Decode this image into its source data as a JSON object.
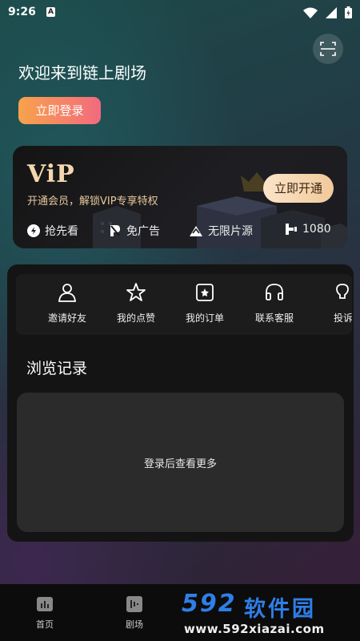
{
  "status_bar": {
    "time": "9:26",
    "notification_icon": "A",
    "icons": [
      "wifi-icon",
      "signal-icon",
      "battery-icon"
    ]
  },
  "header": {
    "welcome": "欢迎来到链上剧场",
    "login_label": "立即登录",
    "scan_icon": "scan-icon"
  },
  "vip": {
    "logo": "ViP",
    "subtitle": "开通会员，解锁VIP专享特权",
    "open_label": "立即开通",
    "perks": [
      {
        "icon": "lightning-icon",
        "label": "抢先看"
      },
      {
        "icon": "no-ad-icon",
        "label": "免广告"
      },
      {
        "icon": "film-icon",
        "label": "无限片源"
      },
      {
        "icon": "hd-icon",
        "label": "1080"
      }
    ]
  },
  "quick_actions": [
    {
      "icon": "invite-user-icon",
      "label": "邀请好友"
    },
    {
      "icon": "star-icon",
      "label": "我的点赞"
    },
    {
      "icon": "order-icon",
      "label": "我的订单"
    },
    {
      "icon": "headset-icon",
      "label": "联系客服"
    },
    {
      "icon": "complaint-icon",
      "label": "投诉"
    }
  ],
  "history": {
    "title": "浏览记录",
    "empty_text": "登录后查看更多"
  },
  "bottom_nav": [
    {
      "icon": "home-icon",
      "label": "首页"
    },
    {
      "icon": "theater-icon",
      "label": "剧场"
    }
  ],
  "watermark": {
    "logo": "592",
    "text": "软件园",
    "url": "www.592xiazai.com"
  },
  "colors": {
    "vip_gold": "#f4d7ae",
    "login_gradient_start": "#f7a34c",
    "login_gradient_end": "#f26a7e",
    "panel": "#141414",
    "watermark_blue": "#2f7fe8"
  }
}
